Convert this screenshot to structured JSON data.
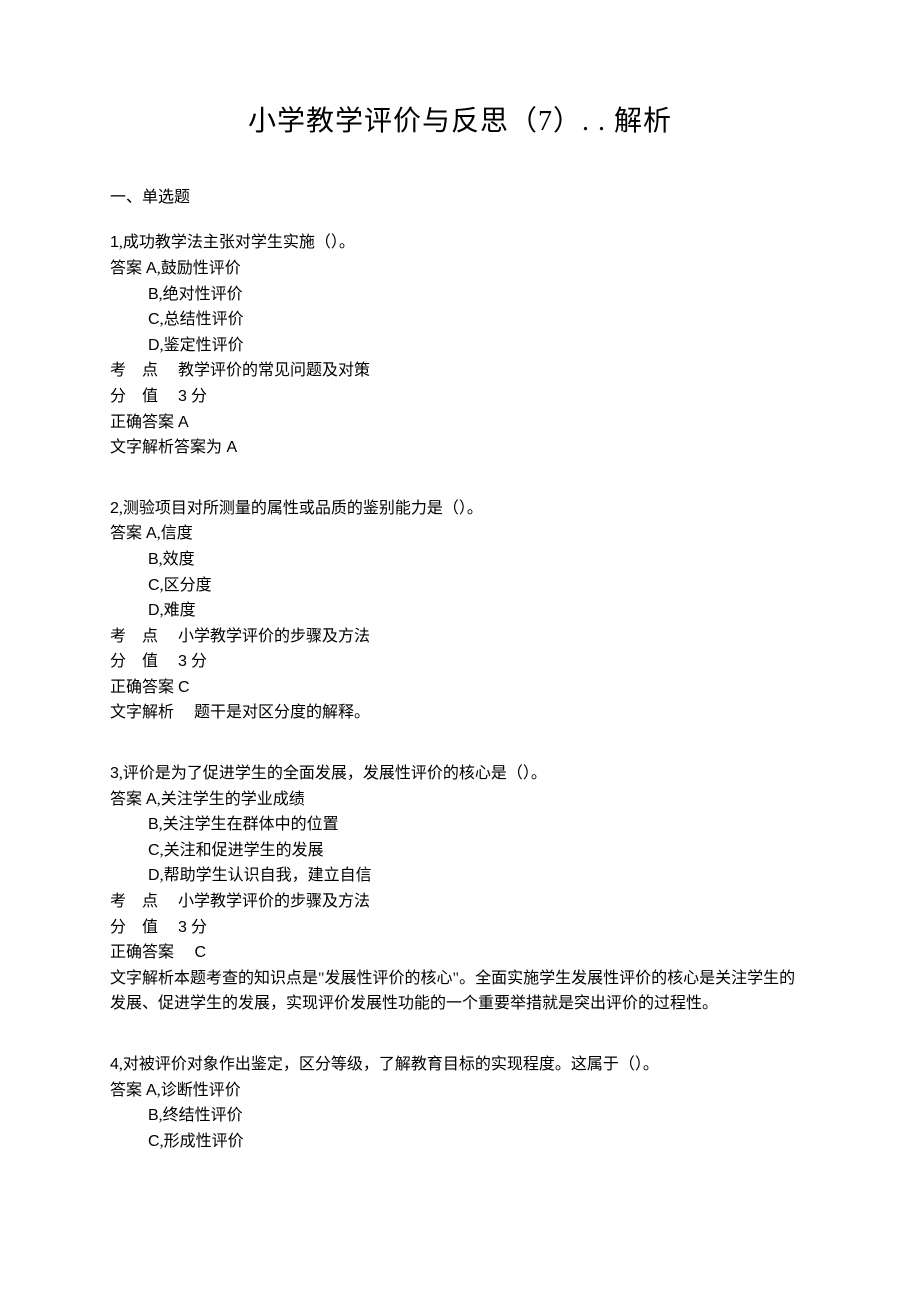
{
  "title": "小学教学评价与反思（7）. . 解析",
  "section_header": "一、单选题",
  "labels": {
    "answer_prefix": "答案 ",
    "exam_point": "考",
    "exam_point2": "点",
    "score": "分",
    "score2": "值",
    "score_unit": " 分",
    "correct_answer": "正确答案 ",
    "text_analysis": "文字解析"
  },
  "questions": [
    {
      "num": "1",
      "text": ",成功教学法主张对学生实施（）。",
      "options": {
        "A": ",鼓励性评价",
        "B": ",绝对性评价",
        "C": ",总结性评价",
        "D": ",鉴定性评价"
      },
      "exam_point": "教学评价的常见问题及对策",
      "score": "3",
      "correct": "A",
      "analysis_label": "文字解析答案为",
      "analysis": " A"
    },
    {
      "num": "2",
      "text": ",测验项目对所测量的属性或品质的鉴别能力是（）。",
      "options": {
        "A": ",信度",
        "B": ",效度",
        "C": ",区分度",
        "D": ",难度"
      },
      "exam_point": "小学教学评价的步骤及方法",
      "score": "3",
      "correct": "C",
      "analysis_label": "文字解析",
      "analysis": "题干是对区分度的解释。"
    },
    {
      "num": "3",
      "text": ",评价是为了促进学生的全面发展，发展性评价的核心是（）。",
      "options": {
        "A": ",关注学生的学业成绩",
        "B": ",关注学生在群体中的位置",
        "C": ",关注和促进学生的发展",
        "D": ",帮助学生认识自我，建立自信"
      },
      "exam_point": "小学教学评价的步骤及方法",
      "score": "3",
      "correct": " C",
      "correct_spacer": "    ",
      "analysis_label": "文字解析",
      "analysis": "本题考查的知识点是\"发展性评价的核心\"。全面实施学生发展性评价的核心是关注学生的发展、促进学生的发展，实现评价发展性功能的一个重要举措就是突出评价的过程性。"
    },
    {
      "num": "4",
      "text": ",对被评价对象作出鉴定，区分等级，了解教育目标的实现程度。这属于（）。",
      "options": {
        "A": ",诊断性评价",
        "B": ",终结性评价",
        "C": ",形成性评价"
      }
    }
  ]
}
